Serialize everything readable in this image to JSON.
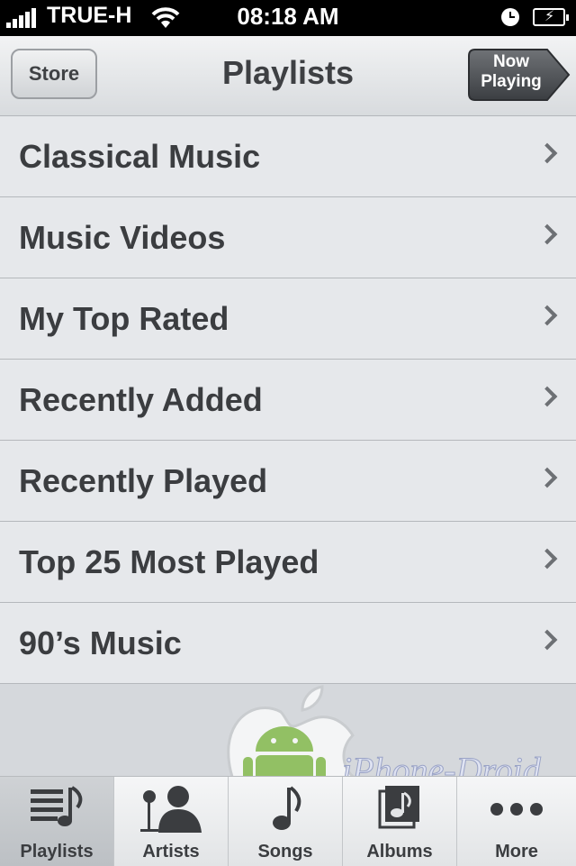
{
  "status_bar": {
    "carrier": "TRUE-H",
    "time": "08:18 AM"
  },
  "nav": {
    "back_label": "Store",
    "title": "Playlists",
    "now_playing_line1": "Now",
    "now_playing_line2": "Playing"
  },
  "playlists": [
    {
      "label": "Classical Music"
    },
    {
      "label": "Music Videos"
    },
    {
      "label": "My Top Rated"
    },
    {
      "label": "Recently Added"
    },
    {
      "label": "Recently Played"
    },
    {
      "label": "Top 25 Most Played"
    },
    {
      "label": "90’s Music"
    }
  ],
  "watermark": {
    "text": "iPhone-Droid"
  },
  "tabs": [
    {
      "label": "Playlists",
      "icon": "playlists-icon",
      "selected": true
    },
    {
      "label": "Artists",
      "icon": "artists-icon",
      "selected": false
    },
    {
      "label": "Songs",
      "icon": "songs-icon",
      "selected": false
    },
    {
      "label": "Albums",
      "icon": "albums-icon",
      "selected": false
    },
    {
      "label": "More",
      "icon": "more-icon",
      "selected": false
    }
  ],
  "colors": {
    "list_bg": "#e6e8eb",
    "text": "#3b3d40",
    "status_bar": "#000000"
  }
}
